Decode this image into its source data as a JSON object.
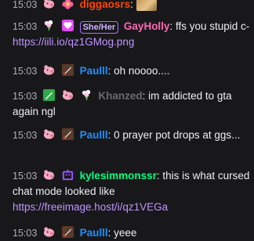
{
  "messages": [
    {
      "time": "15:03",
      "user": "diggaosrs",
      "user_color": "#ff4500"
    },
    {
      "time": "15:03",
      "pronoun": "She/Her",
      "user": "GayHolly",
      "user_color": "#ff69b4",
      "text": ": ffs you stupid c- ",
      "link": "https://iili.io/qz1GMog.png"
    },
    {
      "time": "15:03",
      "user": "Paulll",
      "user_color": "#1e90ff",
      "text": ": oh noooo...."
    },
    {
      "time": "15:03",
      "user": "Khanzed",
      "user_color": "#6b6b6b",
      "text": ": im addicted to gta again ngl"
    },
    {
      "time": "15:03",
      "user": "Paulll",
      "user_color": "#1e90ff",
      "text": ": 0 prayer pot drops at ggs..."
    },
    {
      "time": "15:03",
      "user": "kylesimmonssr",
      "user_color": "#00ff7f",
      "text": ": this is what cursed chat mode looked like",
      "link": "https://freeimage.host/i/qz1VEGa"
    },
    {
      "time": "15:03",
      "user": "Paulll",
      "user_color": "#1e90ff",
      "text": ": yeee"
    }
  ]
}
